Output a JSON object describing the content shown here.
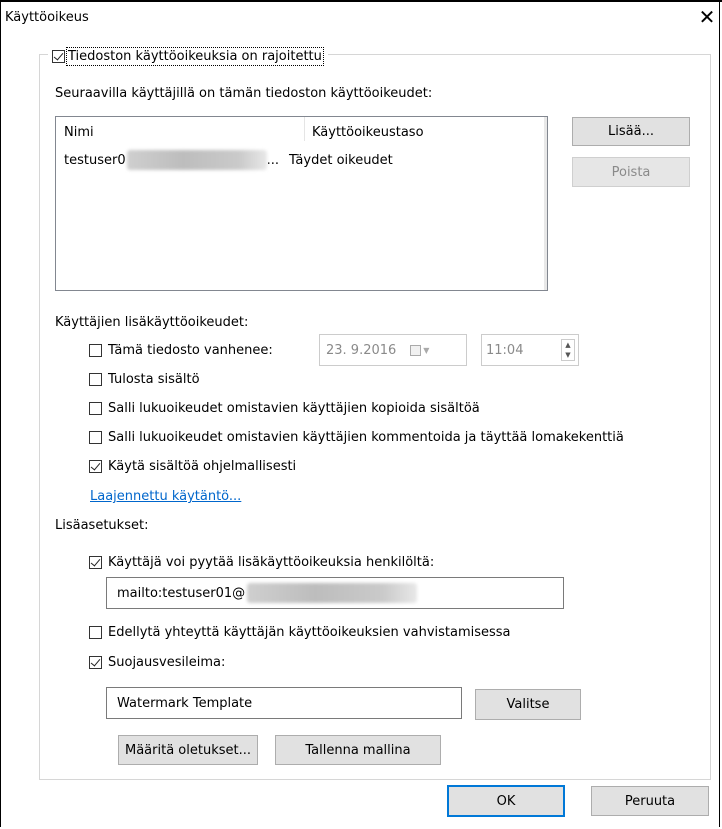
{
  "window": {
    "title": "Käyttöoikeus",
    "close_symbol": "✕"
  },
  "restrict": {
    "label": "Tiedoston käyttöoikeuksia on rajoitettu",
    "checked": true
  },
  "users_section": {
    "heading": "Seuraavilla käyttäjillä on tämän tiedoston käyttöoikeudet:",
    "columns": [
      "Nimi",
      "Käyttöoikeustaso"
    ],
    "rows": [
      {
        "name": "testuser0",
        "ellipsis": "...",
        "level": "Täydet oikeudet"
      }
    ],
    "add_button": "Lisää...",
    "remove_button": "Poista"
  },
  "additional_rights": {
    "heading": "Käyttäjien lisäkäyttöoikeudet:",
    "expires": {
      "label": "Tämä tiedosto vanhenee:",
      "checked": false,
      "date": "23. 9.2016",
      "time": "11:04"
    },
    "print": {
      "label": "Tulosta sisältö",
      "checked": false
    },
    "copy": {
      "label": "Salli lukuoikeudet omistavien käyttäjien kopioida sisältöä",
      "checked": false
    },
    "comment": {
      "label": "Salli lukuoikeudet omistavien käyttäjien kommentoida ja täyttää lomakekenttiä",
      "checked": false
    },
    "programmatic": {
      "label": "Käytä sisältöä ohjelmallisesti",
      "checked": true
    },
    "advanced_link": "Laajennettu käytäntö..."
  },
  "settings": {
    "heading": "Lisäasetukset:",
    "request": {
      "label": "Käyttäjä voi pyytää lisäkäyttöoikeuksia henkilöltä:",
      "checked": true,
      "value": "mailto:testuser01@"
    },
    "verify": {
      "label": "Edellytä yhteyttä käyttäjän käyttöoikeuksien vahvistamisessa",
      "checked": false
    },
    "watermark": {
      "label": "Suojausvesileima:",
      "checked": true,
      "value": "Watermark Template",
      "select_button": "Valitse"
    }
  },
  "buttons": {
    "defaults": "Määritä oletukset...",
    "save_template": "Tallenna mallina",
    "ok": "OK",
    "cancel": "Peruuta"
  },
  "icons": {
    "close": "close-icon",
    "calendar": "calendar-icon",
    "spin": "spin-up-down-icon"
  }
}
